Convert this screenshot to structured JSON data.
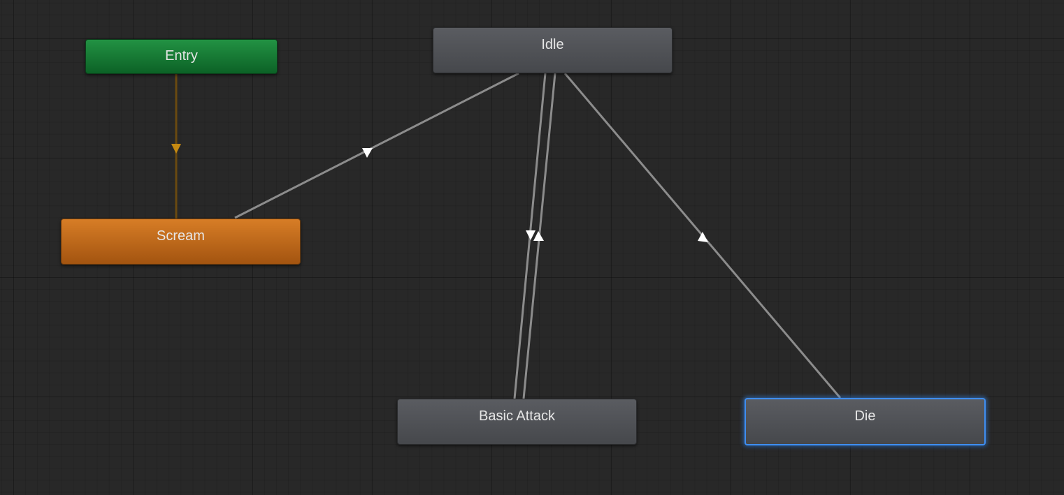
{
  "states": {
    "entry": "Entry",
    "idle": "Idle",
    "scream": "Scream",
    "basic_attack": "Basic Attack",
    "die": "Die"
  },
  "colors": {
    "background": "#282828",
    "entry": "#1a7c36",
    "default_state": "#c36a1b",
    "state": "#505256",
    "transition": "#8c8c8c",
    "entry_transition": "#6a4a10",
    "entry_arrow": "#c68a12",
    "selection": "#3f8ef0"
  },
  "transitions": [
    {
      "from": "Entry",
      "to": "Scream"
    },
    {
      "from": "Scream",
      "to": "Idle"
    },
    {
      "from": "Idle",
      "to": "Basic Attack"
    },
    {
      "from": "Basic Attack",
      "to": "Idle"
    },
    {
      "from": "Die",
      "to": "Idle"
    }
  ],
  "selected_state": "Die"
}
